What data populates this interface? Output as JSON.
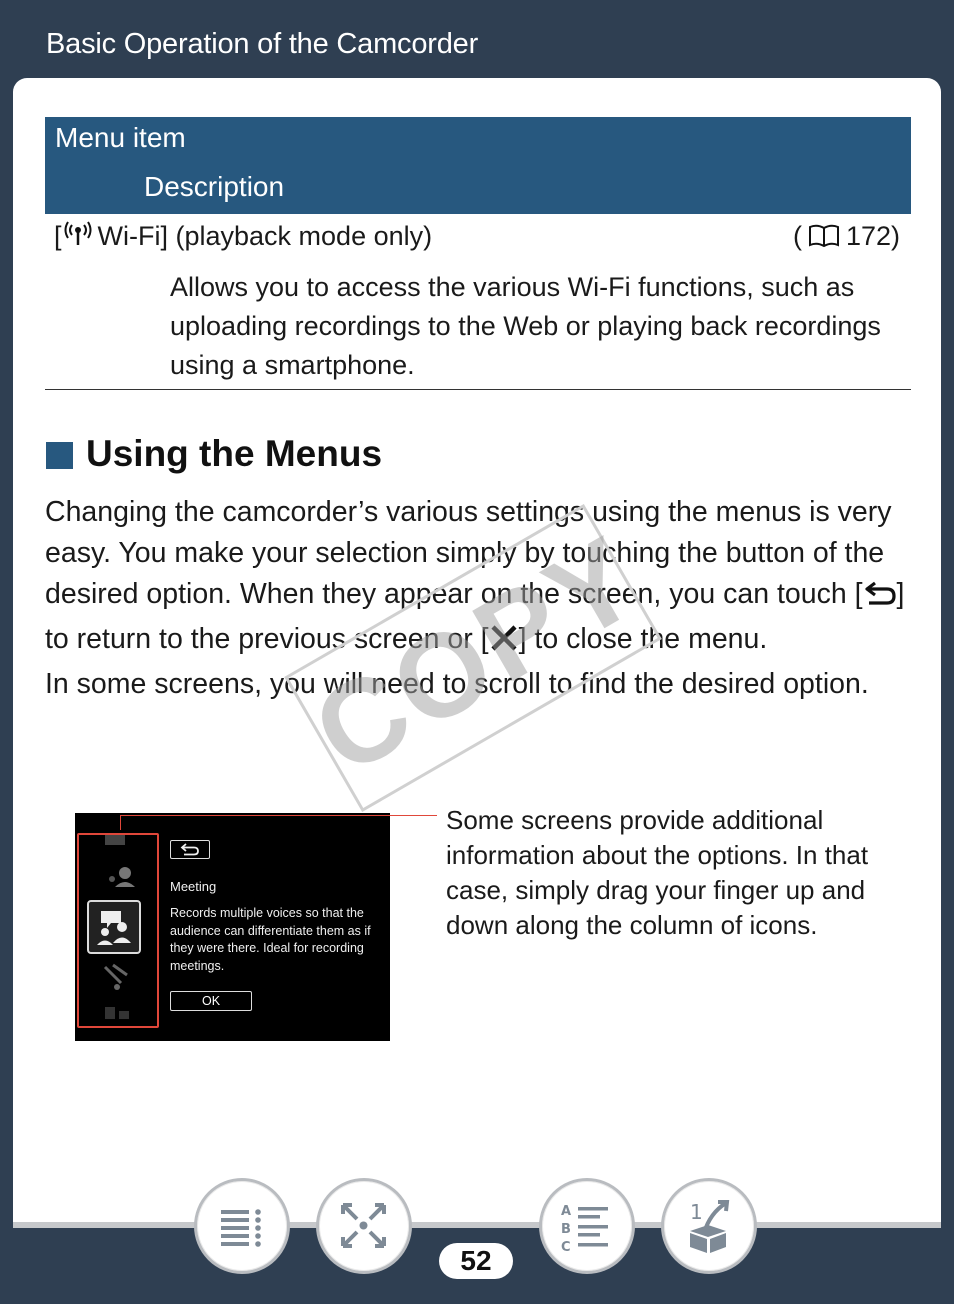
{
  "header": {
    "chapter_title": "Basic Operation of the Camcorder"
  },
  "menu_table": {
    "col_header_1": "Menu item",
    "col_header_2": "Description",
    "row": {
      "item_prefix": "[",
      "item_label": "Wi-Fi] (playback mode only)",
      "page_ref_open": "(",
      "page_ref": "172)",
      "description": "Allows you to access the various Wi-Fi functions, such as uploading recordings to the Web or playing back recordings using a smartphone."
    }
  },
  "section": {
    "title": "Using the Menus",
    "para1_a": "Changing the camcorder’s various settings using the menus is very easy. You make your selection simply by touching the button of the desired option. When they appear on the screen, you can touch [",
    "para1_b": "] to return to the previous screen or [",
    "para1_c": "] to close the menu.",
    "para2": "In some screens, you will need to scroll to find the desired option."
  },
  "watermark": "COPY",
  "camera_screen": {
    "title": "Meeting",
    "description": "Records multiple voices so that the audience can differentiate them as if they were there. Ideal for recording meetings.",
    "ok_label": "OK"
  },
  "callout": "Some screens provide additional information about the options. In that case, simply drag your finger up and down along the column of icons.",
  "footer": {
    "page_number": "52",
    "icons": [
      "table-of-contents-icon",
      "index-icon",
      "glossary-icon",
      "back-to-previous-icon"
    ]
  },
  "colors": {
    "header_bg": "#2f3f52",
    "accent_blue": "#27587f",
    "highlight_red": "#e0473a"
  }
}
